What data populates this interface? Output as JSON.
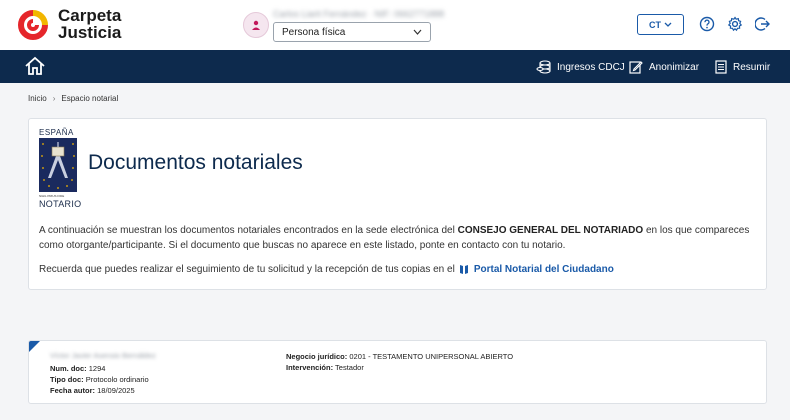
{
  "app": {
    "logo_line1": "Carpeta",
    "logo_line2": "Justicia"
  },
  "header": {
    "user_name": "Carlos Liarit Fernández · NIF: 0662771888",
    "profile_selected": "Persona física",
    "language": "CT",
    "icons": [
      "help-icon",
      "settings-icon",
      "logout-icon"
    ]
  },
  "nav": {
    "items": [
      {
        "label": "Ingresos CDCJ",
        "icon": "coins-icon"
      },
      {
        "label": "Anonimizar",
        "icon": "edit-document-icon"
      },
      {
        "label": "Resumir",
        "icon": "list-document-icon"
      }
    ]
  },
  "breadcrumb": {
    "home": "Inicio",
    "current": "Espacio notarial"
  },
  "notary_logo": {
    "top": "ESPAÑA",
    "motto": "NIHIL PRIUS FIDE",
    "bottom": "NOTARIO"
  },
  "card": {
    "title": "Documentos notariales",
    "text_before": "A continuación se muestran los documentos notariales encontrados en la sede electrónica del ",
    "text_bold": "CONSEJO GENERAL DEL NOTARIADO",
    "text_after": " en los que compareces como otorgante/participante. Si el documento que buscas no aparece en este listado, ponte en contacto con tu notario.",
    "text2": "Recuerda que puedes realizar el seguimiento de tu solicitud y la recepción de tus copias en el",
    "link_label": "Portal Notarial del Ciudadano"
  },
  "document": {
    "holder": "Víctor Javier Asensio Bernáldez",
    "num_label": "Num. doc:",
    "num_value": "1294",
    "type_label": "Tipo doc:",
    "type_value": "Protocolo ordinario",
    "date_label": "Fecha autor:",
    "date_value": "18/09/2025",
    "business_label": "Negocio jurídico:",
    "business_value": "0201 - TESTAMENTO UNIPERSONAL ABIERTO",
    "intervention_label": "Intervención:",
    "intervention_value": "Testador"
  },
  "colors": {
    "navy": "#0d2a4d",
    "link_blue": "#1a5aa8",
    "logo_red": "#e5262b",
    "logo_yellow": "#f2b600"
  }
}
